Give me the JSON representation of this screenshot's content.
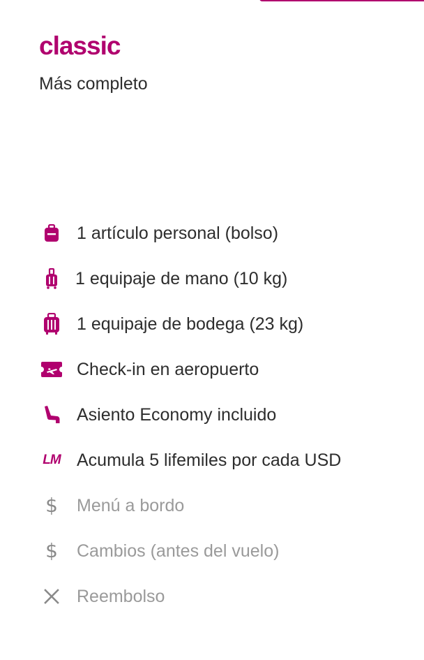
{
  "card": {
    "title": "classic",
    "subtitle": "Más completo"
  },
  "colors": {
    "accent": "#b0006e",
    "text": "#2d2d2d",
    "muted": "#9a9a9a"
  },
  "benefits": [
    {
      "icon": "backpack-icon",
      "label": "1 artículo personal (bolso)",
      "included": true
    },
    {
      "icon": "carry-on-suitcase-icon",
      "label": "1 equipaje de mano (10 kg)",
      "included": true
    },
    {
      "icon": "checked-luggage-icon",
      "label": "1 equipaje de bodega (23 kg)",
      "included": true
    },
    {
      "icon": "boarding-pass-icon",
      "label": "Check-in en aeropuerto",
      "included": true
    },
    {
      "icon": "seat-icon",
      "label": "Asiento Economy incluido",
      "included": true
    },
    {
      "icon": "lifemiles-icon",
      "label": "Acumula 5 lifemiles por cada USD",
      "included": true
    },
    {
      "icon": "dollar-icon",
      "label": "Menú a bordo",
      "included": false
    },
    {
      "icon": "dollar-icon",
      "label": "Cambios (antes del vuelo)",
      "included": false
    },
    {
      "icon": "close-icon",
      "label": "Reembolso",
      "included": false
    }
  ],
  "lm_mark": "LM",
  "dollar_glyph": "$"
}
